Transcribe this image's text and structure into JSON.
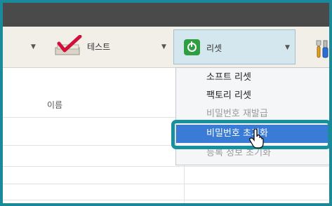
{
  "toolbar": {
    "test_label": "테스트",
    "reset_label": "리셋"
  },
  "table": {
    "columns": [
      "이름"
    ]
  },
  "reset_menu": {
    "items": [
      {
        "label": "소프트 리셋",
        "state": "normal"
      },
      {
        "label": "팩토리 리셋",
        "state": "normal"
      },
      {
        "label": "비밀번호 재발급",
        "state": "partially-hidden"
      },
      {
        "label": "비밀번호 초기화",
        "state": "hovered"
      },
      {
        "label": "등록 정보 초기화",
        "state": "dimmed"
      }
    ]
  },
  "colors": {
    "highlight_ring": "#14909e",
    "selected_item": "#3a7bd5",
    "reset_button_bg": "#d4e7ee"
  }
}
